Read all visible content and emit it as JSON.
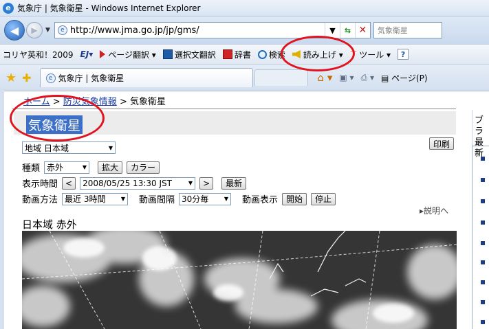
{
  "window": {
    "title": "気象庁 | 気象衛星 - Windows Internet Explorer"
  },
  "address": {
    "url": "http://www.jma.go.jp/jp/gms/",
    "search_placeholder": "気象衛星"
  },
  "toolbar": {
    "item1": "コリヤ英和！2009",
    "item2": "EJ▾",
    "item3": "ページ翻訳 ▾",
    "item4": "選択文翻訳",
    "item5": "辞書",
    "item6": "検索",
    "item7": "読み上げ ▾",
    "item8": "ツール ▾"
  },
  "tab": {
    "label": "気象庁 | 気象衛星"
  },
  "commandbar": {
    "page_label": "ページ(P)"
  },
  "page": {
    "breadcrumb_home": "ホーム",
    "breadcrumb_sep1": " > ",
    "breadcrumb_disaster": "防災気象情報",
    "breadcrumb_sep2": " > ",
    "breadcrumb_current": "気象衛星",
    "title": "気象衛星",
    "region_label": "地域",
    "region_value": "日本域",
    "type_label": "種類",
    "type_value": "赤外",
    "zoom_button": "拡大",
    "color_button": "カラー",
    "print_button": "印刷",
    "time_label": "表示時間",
    "time_value": "2008/05/25 13:30 JST",
    "latest_button": "最新",
    "anim_method_label": "動画方法",
    "anim_method_value": "最近  3時間",
    "anim_interval_label": "動画間隔",
    "anim_interval_value": "30分毎",
    "anim_display_label": "動画表示",
    "start_button": "開始",
    "stop_button": "停止",
    "explain_link": "▸説明へ",
    "image_title": "日本域  赤外",
    "right_heading_1": "ブラ",
    "right_heading_2": "最新"
  },
  "icons": {
    "back": "back-arrow-icon",
    "forward": "forward-arrow-icon",
    "refresh": "refresh-icon",
    "stop": "stop-icon",
    "favorites": "favorites-star-icon",
    "home": "home-icon"
  }
}
